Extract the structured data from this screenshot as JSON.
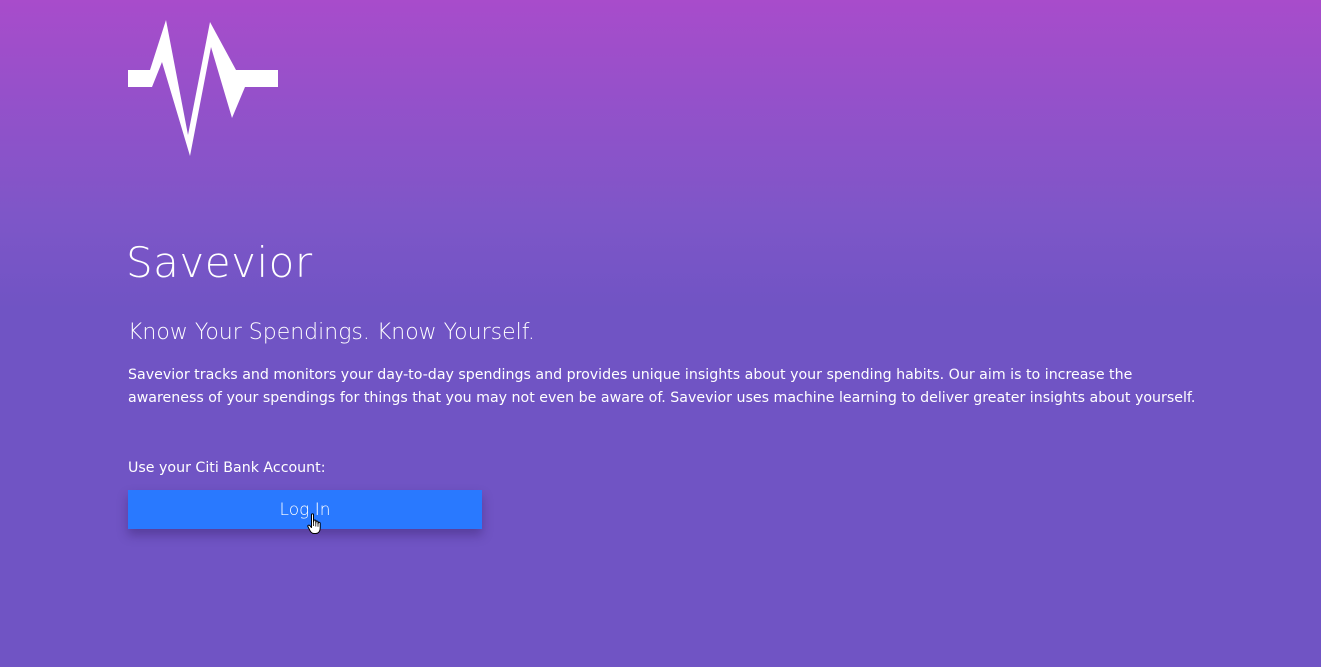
{
  "app": {
    "logo_icon": "pulse-waveform-icon",
    "title": "Savevior",
    "tagline": "Know Your Spendings. Know Yourself.",
    "description": "Savevior tracks and monitors your day-to-day spendings and provides unique insights about your spending habits. Our aim is to increase the awareness of your spendings for things that you may not even be aware of. Savevior uses machine learning to deliver greater insights about yourself."
  },
  "login": {
    "label": "Use your Citi Bank Account:",
    "button_label": "Log In",
    "cursor_icon": "hand-pointer-cursor-icon"
  },
  "colors": {
    "background_top": "#a84ccb",
    "background_bottom": "#7054c4",
    "button": "#2979ff",
    "text": "#ffffff"
  }
}
